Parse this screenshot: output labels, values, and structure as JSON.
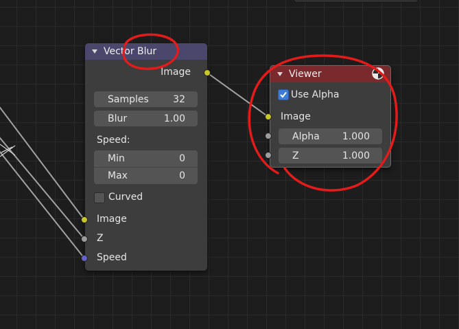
{
  "colors": {
    "vector_blur_header": "#4a466c",
    "viewer_header": "#7a2a2d",
    "socket_color": "#c7c729",
    "socket_value": "#9c9c9c",
    "socket_vector": "#6363c7",
    "annotation_red": "#e21b1b",
    "link": "#a3a3a3"
  },
  "vector_blur": {
    "title": "Vector Blur",
    "output_image": "Image",
    "samples_label": "Samples",
    "samples_value": "32",
    "blur_label": "Blur",
    "blur_value": "1.00",
    "speed_label": "Speed:",
    "min_label": "Min",
    "min_value": "0",
    "max_label": "Max",
    "max_value": "0",
    "curved_label": "Curved",
    "curved_checked": false,
    "input_image": "Image",
    "input_z": "Z",
    "input_speed": "Speed"
  },
  "viewer": {
    "title": "Viewer",
    "use_alpha_label": "Use Alpha",
    "use_alpha_checked": true,
    "input_image": "Image",
    "alpha_label": "Alpha",
    "alpha_value": "1.000",
    "z_label": "Z",
    "z_value": "1.000"
  }
}
